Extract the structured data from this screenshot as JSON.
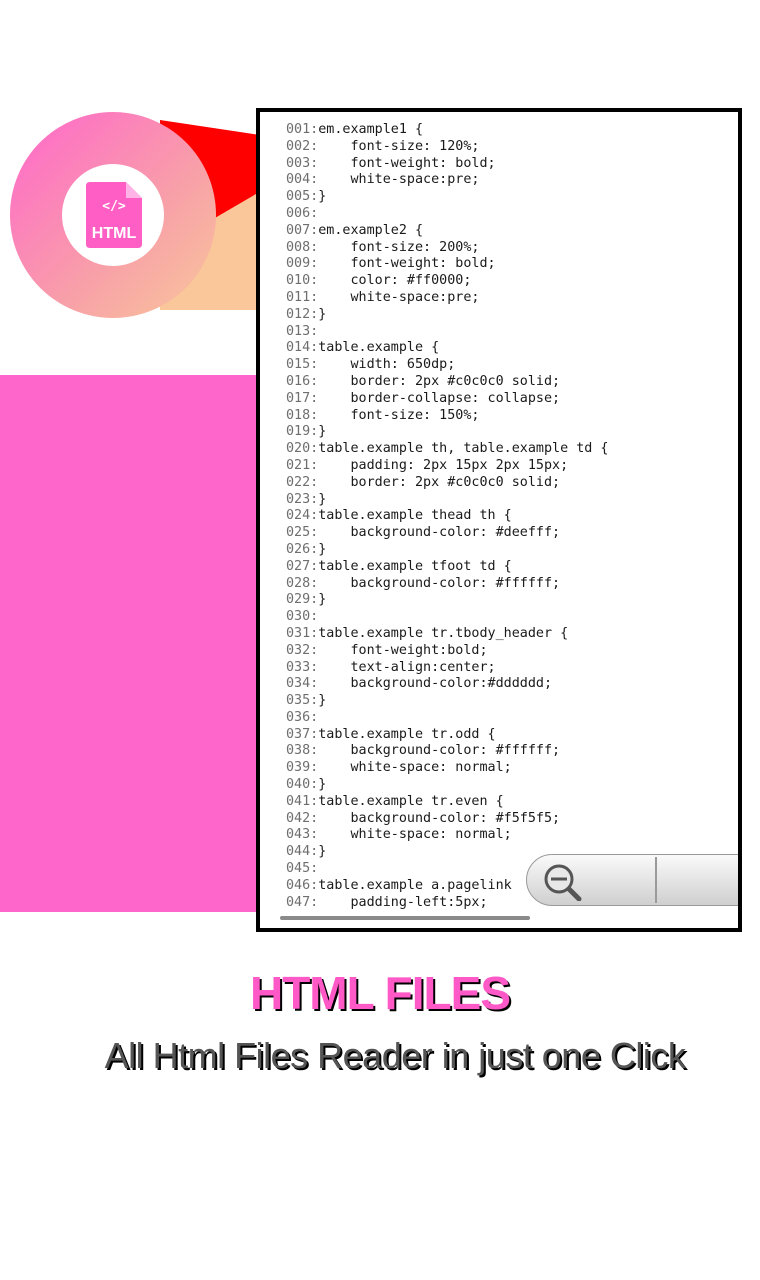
{
  "badge": {
    "icon": "html-file-icon",
    "label": "HTML"
  },
  "code_lines": [
    {
      "n": "001:",
      "t": "em.example1 {"
    },
    {
      "n": "002:",
      "t": "    font-size: 120%;"
    },
    {
      "n": "003:",
      "t": "    font-weight: bold;"
    },
    {
      "n": "004:",
      "t": "    white-space:pre;"
    },
    {
      "n": "005:",
      "t": "}"
    },
    {
      "n": "006:",
      "t": ""
    },
    {
      "n": "007:",
      "t": "em.example2 {"
    },
    {
      "n": "008:",
      "t": "    font-size: 200%;"
    },
    {
      "n": "009:",
      "t": "    font-weight: bold;"
    },
    {
      "n": "010:",
      "t": "    color: #ff0000;"
    },
    {
      "n": "011:",
      "t": "    white-space:pre;"
    },
    {
      "n": "012:",
      "t": "}"
    },
    {
      "n": "013:",
      "t": ""
    },
    {
      "n": "014:",
      "t": "table.example {"
    },
    {
      "n": "015:",
      "t": "    width: 650dp;"
    },
    {
      "n": "016:",
      "t": "    border: 2px #c0c0c0 solid;"
    },
    {
      "n": "017:",
      "t": "    border-collapse: collapse;"
    },
    {
      "n": "018:",
      "t": "    font-size: 150%;"
    },
    {
      "n": "019:",
      "t": "}"
    },
    {
      "n": "020:",
      "t": "table.example th, table.example td {"
    },
    {
      "n": "021:",
      "t": "    padding: 2px 15px 2px 15px;"
    },
    {
      "n": "022:",
      "t": "    border: 2px #c0c0c0 solid;"
    },
    {
      "n": "023:",
      "t": "}"
    },
    {
      "n": "024:",
      "t": "table.example thead th {"
    },
    {
      "n": "025:",
      "t": "    background-color: #deefff;"
    },
    {
      "n": "026:",
      "t": "}"
    },
    {
      "n": "027:",
      "t": "table.example tfoot td {"
    },
    {
      "n": "028:",
      "t": "    background-color: #ffffff;"
    },
    {
      "n": "029:",
      "t": "}"
    },
    {
      "n": "030:",
      "t": ""
    },
    {
      "n": "031:",
      "t": "table.example tr.tbody_header {"
    },
    {
      "n": "032:",
      "t": "    font-weight:bold;"
    },
    {
      "n": "033:",
      "t": "    text-align:center;"
    },
    {
      "n": "034:",
      "t": "    background-color:#dddddd;"
    },
    {
      "n": "035:",
      "t": "}"
    },
    {
      "n": "036:",
      "t": ""
    },
    {
      "n": "037:",
      "t": "table.example tr.odd {"
    },
    {
      "n": "038:",
      "t": "    background-color: #ffffff;"
    },
    {
      "n": "039:",
      "t": "    white-space: normal;"
    },
    {
      "n": "040:",
      "t": "}"
    },
    {
      "n": "041:",
      "t": "table.example tr.even {"
    },
    {
      "n": "042:",
      "t": "    background-color: #f5f5f5;"
    },
    {
      "n": "043:",
      "t": "    white-space: normal;"
    },
    {
      "n": "044:",
      "t": "}"
    },
    {
      "n": "045:",
      "t": ""
    },
    {
      "n": "046:",
      "t": "table.example a.pagelink"
    },
    {
      "n": "047:",
      "t": "    padding-left:5px;"
    }
  ],
  "zoom_controls": {
    "zoom_out_icon": "zoom-out-icon",
    "zoom_in_icon": "zoom-in-icon"
  },
  "footer": {
    "title": "HTML FILES",
    "subtitle": "All Html Files Reader in just one Click"
  },
  "colors": {
    "accent_pink": "#ff66cc",
    "title_pink": "#ff59c8",
    "pointer_red": "#ff0000",
    "subtitle_gray": "#555555"
  }
}
